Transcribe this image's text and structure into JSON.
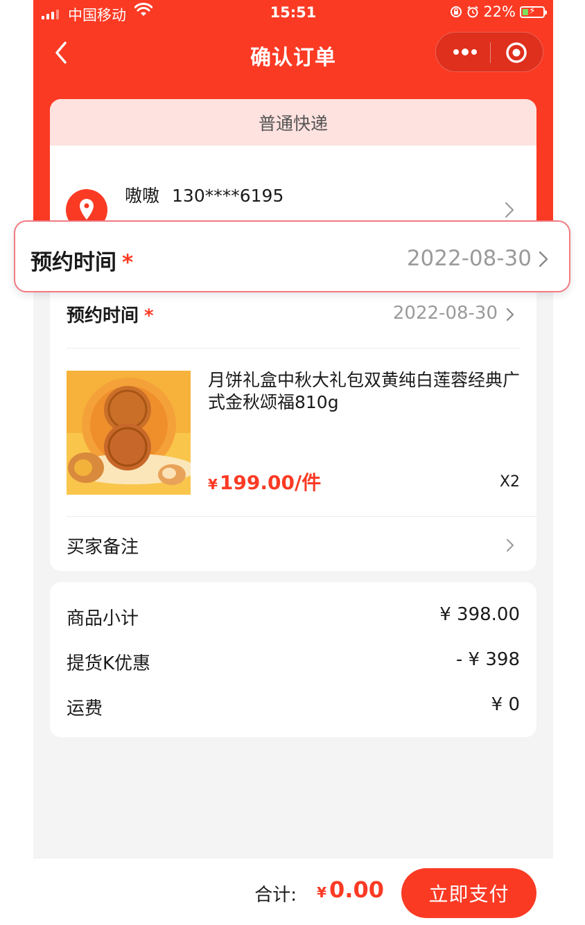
{
  "status_bar": {
    "carrier": "中国移动",
    "time": "15:51",
    "battery": "22%"
  },
  "nav": {
    "title": "确认订单"
  },
  "delivery": {
    "tab_label": "普通快递"
  },
  "address": {
    "name": "嗷嗷",
    "phone": "130****6195"
  },
  "appointment": {
    "label": "预约时间",
    "required_mark": "*",
    "date": "2022-08-30"
  },
  "product": {
    "name": "月饼礼盒中秋大礼包双黄纯白莲蓉经典广式金秋颂福810g",
    "price_symbol": "¥",
    "price": "199.00/件",
    "quantity": "X2"
  },
  "remark": {
    "label": "买家备注"
  },
  "summary": {
    "rows": [
      {
        "label": "商品小计",
        "value": "¥ 398.00"
      },
      {
        "label": "提货K优惠",
        "value": "- ¥ 398"
      },
      {
        "label": "运费",
        "value": "¥ 0"
      }
    ]
  },
  "footer": {
    "total_label": "合计:",
    "total_symbol": "¥",
    "total_amount": "0.00",
    "pay_button": "立即支付"
  },
  "colors": {
    "brand_red": "#fb3a24",
    "tab_pink": "#fde2df"
  },
  "icons": {
    "back": "back-icon",
    "more": "more-icon",
    "close": "target-icon",
    "location": "location-pin-icon",
    "chevron": "chevron-right-icon"
  }
}
